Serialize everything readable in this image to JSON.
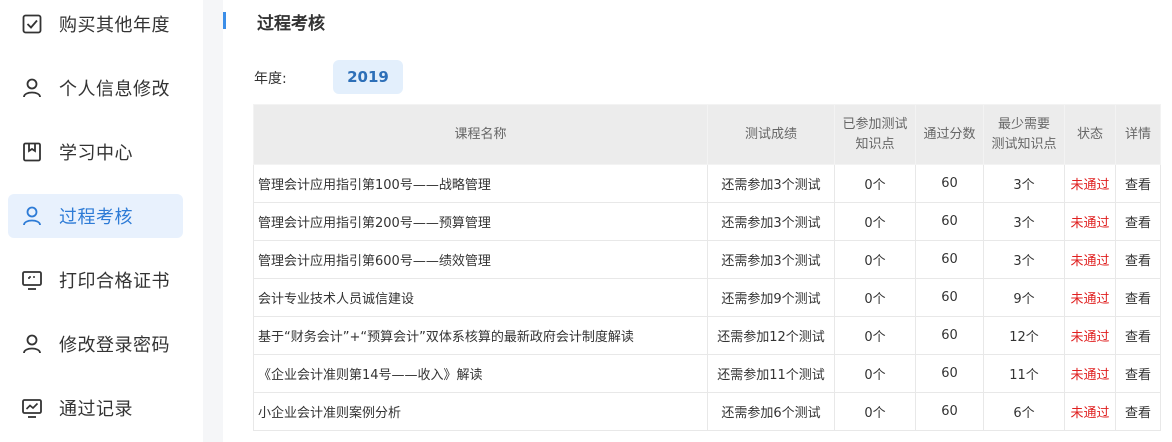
{
  "sidebar": {
    "items": [
      {
        "label": "购买其他年度",
        "icon": "checkbox-icon"
      },
      {
        "label": "个人信息修改",
        "icon": "user-icon"
      },
      {
        "label": "学习中心",
        "icon": "bookmark-icon"
      },
      {
        "label": "过程考核",
        "icon": "user-icon",
        "active": true
      },
      {
        "label": "打印合格证书",
        "icon": "monitor-icon"
      },
      {
        "label": "修改登录密码",
        "icon": "user-icon"
      },
      {
        "label": "通过记录",
        "icon": "chart-monitor-icon"
      }
    ]
  },
  "main": {
    "title": "过程考核",
    "year_label": "年度:",
    "year_value": "2019",
    "table": {
      "headers": {
        "course": "课程名称",
        "score": "测试成绩",
        "joined_1": "已参加测试",
        "joined_2": "知识点",
        "pass": "通过分数",
        "min_1": "最少需要",
        "min_2": "测试知识点",
        "status": "状态",
        "detail": "详情"
      },
      "rows": [
        {
          "course": "管理会计应用指引第100号——战略管理",
          "score": "还需参加3个测试",
          "joined": "0个",
          "pass": "60",
          "min": "3个",
          "status": "未通过",
          "detail": "查看"
        },
        {
          "course": "管理会计应用指引第200号——预算管理",
          "score": "还需参加3个测试",
          "joined": "0个",
          "pass": "60",
          "min": "3个",
          "status": "未通过",
          "detail": "查看"
        },
        {
          "course": "管理会计应用指引第600号——绩效管理",
          "score": "还需参加3个测试",
          "joined": "0个",
          "pass": "60",
          "min": "3个",
          "status": "未通过",
          "detail": "查看"
        },
        {
          "course": "会计专业技术人员诚信建设",
          "score": "还需参加9个测试",
          "joined": "0个",
          "pass": "60",
          "min": "9个",
          "status": "未通过",
          "detail": "查看"
        },
        {
          "course": "基于“财务会计”+“预算会计”双体系核算的最新政府会计制度解读",
          "score": "还需参加12个测试",
          "joined": "0个",
          "pass": "60",
          "min": "12个",
          "status": "未通过",
          "detail": "查看"
        },
        {
          "course": "《企业会计准则第14号——收入》解读",
          "score": "还需参加11个测试",
          "joined": "0个",
          "pass": "60",
          "min": "11个",
          "status": "未通过",
          "detail": "查看"
        },
        {
          "course": "小企业会计准则案例分析",
          "score": "还需参加6个测试",
          "joined": "0个",
          "pass": "60",
          "min": "6个",
          "status": "未通过",
          "detail": "查看"
        }
      ]
    }
  },
  "colors": {
    "accent": "#3b8ee8",
    "active_bg": "#e8f1fd",
    "status_fail": "#e02020",
    "header_bg": "#ececec"
  }
}
